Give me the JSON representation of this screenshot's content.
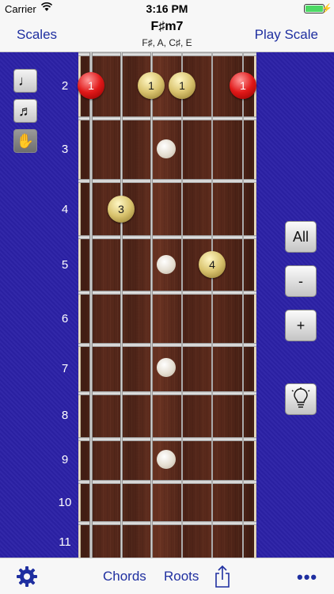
{
  "status_bar": {
    "carrier": "Carrier",
    "time": "3:16 PM",
    "battery_level": 1.0
  },
  "nav": {
    "left_label": "Scales",
    "title": "F♯m7",
    "subtitle": "F♯, A, C♯, E",
    "right_label": "Play Scale"
  },
  "tools": [
    {
      "name": "single-note-icon",
      "glyph": "♩"
    },
    {
      "name": "double-note-icon",
      "glyph": "♬"
    },
    {
      "name": "hand-icon",
      "glyph": "✋"
    }
  ],
  "frets": [
    "2",
    "3",
    "4",
    "5",
    "6",
    "7",
    "8",
    "9",
    "10",
    "11"
  ],
  "notes": [
    {
      "label": "1",
      "type": "root"
    },
    {
      "label": "1",
      "type": "gold"
    },
    {
      "label": "1",
      "type": "gold"
    },
    {
      "label": "1",
      "type": "root"
    },
    {
      "label": "3",
      "type": "gold"
    },
    {
      "label": "4",
      "type": "gold"
    }
  ],
  "side_buttons": {
    "all": "All",
    "minus": "-",
    "plus": "+",
    "light": "lightbulb-icon"
  },
  "tabbar": {
    "chords": "Chords",
    "roots": "Roots",
    "more": "•••"
  },
  "colors": {
    "accent": "#1f2fa0",
    "background": "#2b21a6",
    "root_note": "#e01818",
    "note": "#d9c36e"
  }
}
